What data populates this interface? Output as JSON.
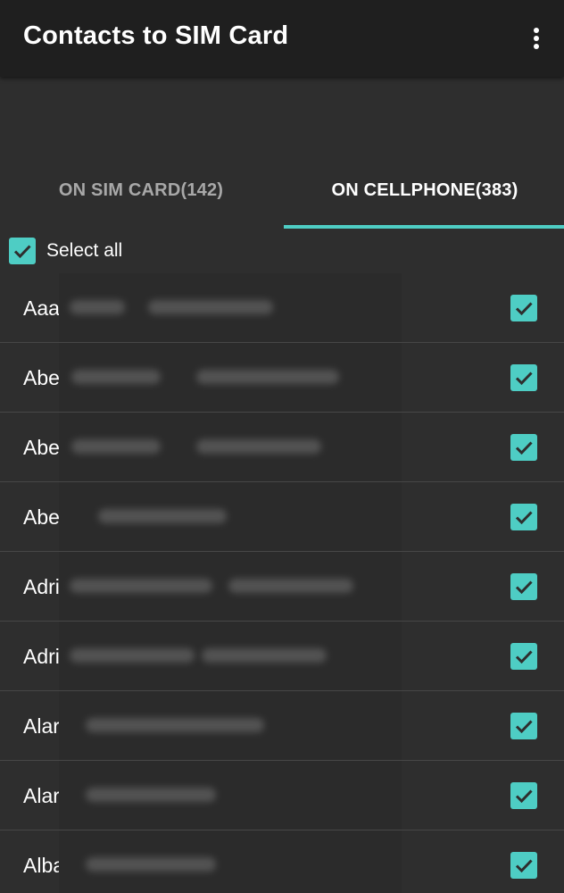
{
  "appbar": {
    "title": "Contacts to SIM Card",
    "overflow_icon": "more-vert-icon"
  },
  "tabs": [
    {
      "label": "ON SIM CARD(142)",
      "selected": false
    },
    {
      "label": "ON CELLPHONE(383)",
      "selected": true
    }
  ],
  "select_all": {
    "label": "Select all",
    "checked": true
  },
  "contacts": [
    {
      "name": "Aaa",
      "checked": true
    },
    {
      "name": "Abe",
      "checked": true
    },
    {
      "name": "Abe",
      "checked": true
    },
    {
      "name": "Abe",
      "checked": true
    },
    {
      "name": "Adri",
      "checked": true
    },
    {
      "name": "Adri",
      "checked": true
    },
    {
      "name": "Alar",
      "checked": true
    },
    {
      "name": "Alar",
      "checked": true
    },
    {
      "name": "Alba",
      "checked": true
    }
  ],
  "colors": {
    "accent": "#4ecdc4",
    "appbar": "#1f1f1f",
    "background": "#2e2e2e",
    "divider": "#474747"
  }
}
